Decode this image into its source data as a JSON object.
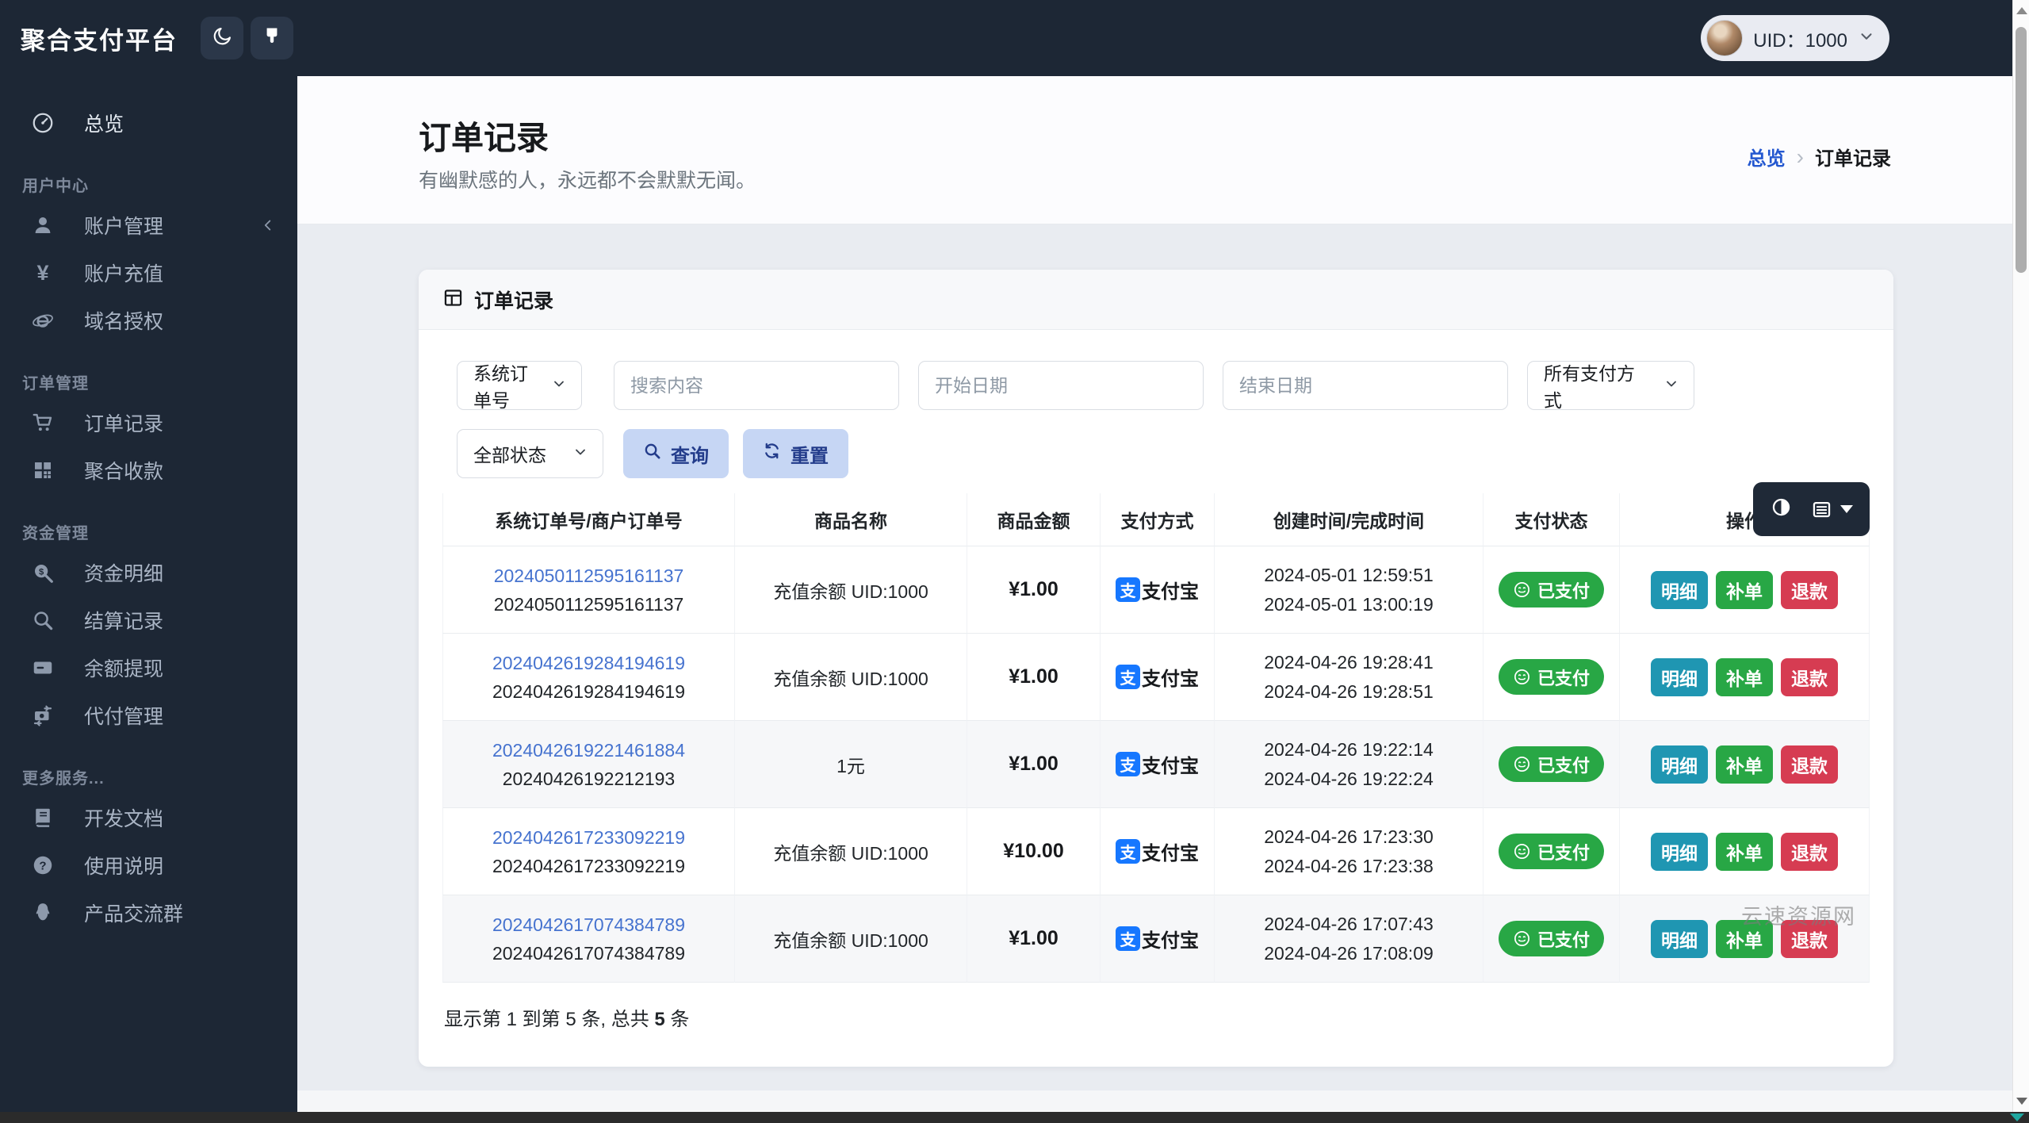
{
  "app": {
    "title": "聚合支付平台"
  },
  "topbar": {
    "uid_label": "UID：1000"
  },
  "sidebar": {
    "overview": {
      "label": "总览"
    },
    "sections": [
      {
        "header": "用户中心",
        "items": [
          {
            "label": "账户管理"
          },
          {
            "label": "账户充值"
          },
          {
            "label": "域名授权"
          }
        ]
      },
      {
        "header": "订单管理",
        "items": [
          {
            "label": "订单记录"
          },
          {
            "label": "聚合收款"
          }
        ]
      },
      {
        "header": "资金管理",
        "items": [
          {
            "label": "资金明细"
          },
          {
            "label": "结算记录"
          },
          {
            "label": "余额提现"
          },
          {
            "label": "代付管理"
          }
        ]
      },
      {
        "header": "更多服务...",
        "items": [
          {
            "label": "开发文档"
          },
          {
            "label": "使用说明"
          },
          {
            "label": "产品交流群"
          }
        ]
      }
    ]
  },
  "page": {
    "title": "订单记录",
    "subtitle": "有幽默感的人，永远都不会默默无闻。",
    "breadcrumb": {
      "root": "总览",
      "separator": "›",
      "current": "订单记录"
    }
  },
  "card": {
    "title": "订单记录"
  },
  "filters": {
    "order_type_select": "系统订单号",
    "search_placeholder": "搜索内容",
    "start_date_placeholder": "开始日期",
    "end_date_placeholder": "结束日期",
    "pay_method_select": "所有支付方式",
    "status_select": "全部状态",
    "query_button": "查询",
    "reset_button": "重置"
  },
  "icon_glyphs": {
    "yen": "¥",
    "alipay": "支"
  },
  "table": {
    "headers": [
      "系统订单号/商户订单号",
      "商品名称",
      "商品金额",
      "支付方式",
      "创建时间/完成时间",
      "支付状态",
      "操作"
    ],
    "rows": [
      {
        "sys_no": "2024050112595161137",
        "merchant_no": "2024050112595161137",
        "product": "充值余额 UID:1000",
        "amount": "¥1.00",
        "pay_method": "支付宝",
        "created": "2024-05-01 12:59:51",
        "completed": "2024-05-01 13:00:19",
        "status": "已支付",
        "actions": [
          "明细",
          "补单",
          "退款"
        ]
      },
      {
        "sys_no": "2024042619284194619",
        "merchant_no": "2024042619284194619",
        "product": "充值余额 UID:1000",
        "amount": "¥1.00",
        "pay_method": "支付宝",
        "created": "2024-04-26 19:28:41",
        "completed": "2024-04-26 19:28:51",
        "status": "已支付",
        "actions": [
          "明细",
          "补单",
          "退款"
        ]
      },
      {
        "sys_no": "2024042619221461884",
        "merchant_no": "20240426192212193",
        "product": "1元",
        "amount": "¥1.00",
        "pay_method": "支付宝",
        "created": "2024-04-26 19:22:14",
        "completed": "2024-04-26 19:22:24",
        "status": "已支付",
        "actions": [
          "明细",
          "补单",
          "退款"
        ]
      },
      {
        "sys_no": "2024042617233092219",
        "merchant_no": "2024042617233092219",
        "product": "充值余额 UID:1000",
        "amount": "¥10.00",
        "pay_method": "支付宝",
        "created": "2024-04-26 17:23:30",
        "completed": "2024-04-26 17:23:38",
        "status": "已支付",
        "actions": [
          "明细",
          "补单",
          "退款"
        ]
      },
      {
        "sys_no": "2024042617074384789",
        "merchant_no": "2024042617074384789",
        "product": "充值余额 UID:1000",
        "amount": "¥1.00",
        "pay_method": "支付宝",
        "created": "2024-04-26 17:07:43",
        "completed": "2024-04-26 17:08:09",
        "status": "已支付",
        "actions": [
          "明细",
          "补单",
          "退款"
        ]
      }
    ],
    "summary": {
      "prefix": "显示第 1 到第 5 条, 总共 ",
      "total": "5",
      "suffix": " 条"
    }
  },
  "watermark": "云速资源网",
  "colors": {
    "dark": "#1d2735",
    "alipay_blue": "#1677ff",
    "paid_green": "#28a745",
    "detail_teal": "#1f96b2",
    "refund_red": "#d63c52",
    "soft_primary": "#c6d6f4",
    "link_blue": "#4673cf",
    "breadcrumb_blue": "#2458d0"
  }
}
